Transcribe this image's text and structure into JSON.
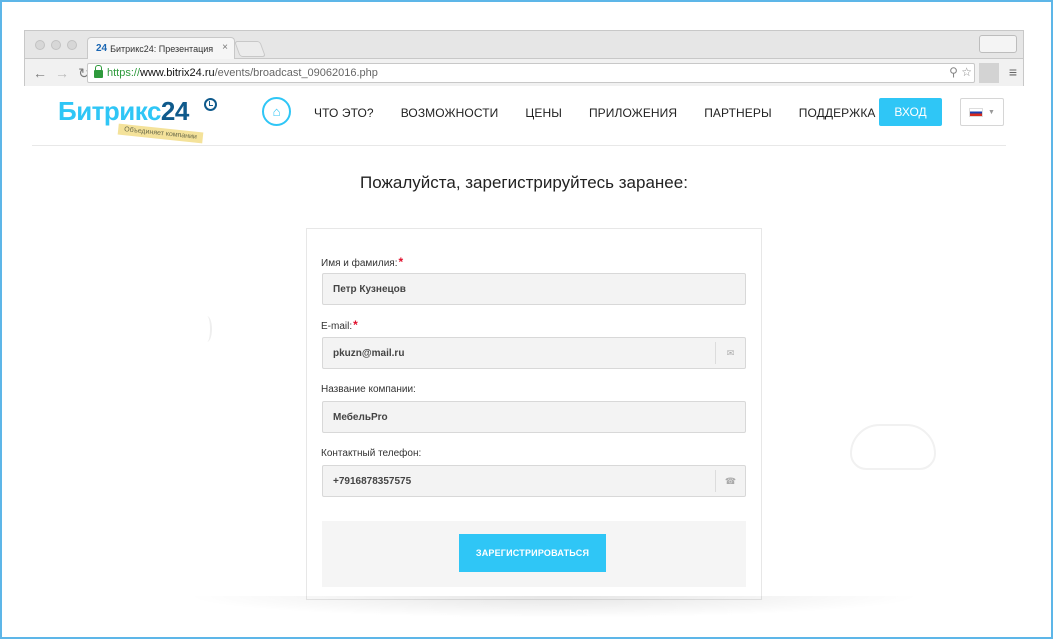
{
  "browser": {
    "tab_title": "Битрикс24: Презентация",
    "tab_favicon": "24",
    "tab_close": "×",
    "url": {
      "protocol": "https://",
      "host": "www.bitrix24.ru",
      "path": "/events/broadcast_09062016.php"
    },
    "icons": [
      "back-arrow",
      "forward-arrow",
      "reload",
      "lock",
      "zoom",
      "star",
      "menu"
    ]
  },
  "site": {
    "logo_text": "Битрикс",
    "logo_number": "24",
    "tagline": "Объединяет компании",
    "nav": [
      "ЧТО ЭТО?",
      "ВОЗМОЖНОСТИ",
      "ЦЕНЫ",
      "ПРИЛОЖЕНИЯ",
      "ПАРТНЕРЫ",
      "ПОДДЕРЖКА"
    ],
    "login_label": "ВХОД",
    "language": "RU",
    "accent_color": "#2fc6f6"
  },
  "form": {
    "headline": "Пожалуйста, зарегистрируйтесь заранее:",
    "fields": [
      {
        "label": "Имя и фамилия:",
        "required": true,
        "value": "Петр Кузнецов",
        "icon": ""
      },
      {
        "label": "E-mail:",
        "required": true,
        "value": "pkuzn@mail.ru",
        "icon": "envelope-icon"
      },
      {
        "label": "Название компании:",
        "required": false,
        "value": "МебельPro",
        "icon": ""
      },
      {
        "label": "Контактный телефон:",
        "required": false,
        "value": "+7916878357575",
        "icon": "phone-icon"
      }
    ],
    "required_mark": "*",
    "submit_label": "ЗАРЕГИСТРИРОВАТЬСЯ"
  }
}
